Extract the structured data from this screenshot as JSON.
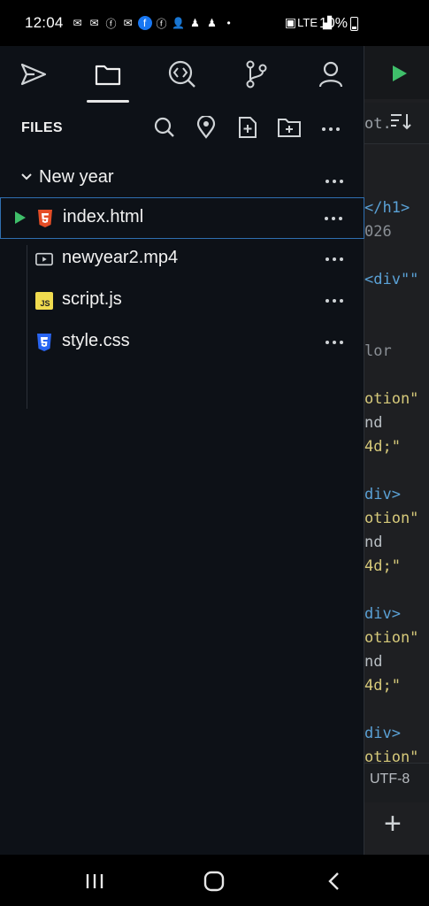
{
  "status_bar": {
    "time": "12:04",
    "network": "LTE",
    "battery": "10%"
  },
  "sidebar": {
    "nav_icons": [
      "send-icon",
      "folder-icon",
      "code-search-icon",
      "git-branch-icon",
      "user-icon"
    ],
    "active_nav": "folder-icon",
    "files_header": {
      "title": "FILES",
      "actions": [
        "search-icon",
        "location-pin-icon",
        "new-file-icon",
        "new-folder-icon",
        "more-icon"
      ]
    },
    "folder": {
      "name": "New year",
      "expanded": true
    },
    "files": [
      {
        "name": "index.html",
        "icon": "html5-icon",
        "active": true
      },
      {
        "name": "newyear2.mp4",
        "icon": "video-icon",
        "active": false
      },
      {
        "name": "script.js",
        "icon": "js-icon",
        "active": false
      },
      {
        "name": "style.css",
        "icon": "css3-icon",
        "active": false
      }
    ]
  },
  "editor": {
    "tab_text": "ot.",
    "code_lines": [
      "</h1>",
      "026",
      "",
      "<div\"\"",
      "",
      "",
      "lor",
      "",
      "otion\"",
      "nd",
      "4d;\"",
      "",
      "div>",
      "otion\"",
      "nd",
      "4d;\"",
      "",
      "div>",
      "otion\"",
      "nd",
      "4d;\"",
      "",
      "div>",
      "otion\""
    ],
    "encoding": "UTF-8"
  },
  "colors": {
    "sidebar_bg": "#0d1117",
    "accent_green": "#3fbf6a",
    "active_border": "#2f6fb0",
    "html_icon": "#e44d26",
    "js_icon": "#f0db4f",
    "css_icon": "#2965f1"
  }
}
